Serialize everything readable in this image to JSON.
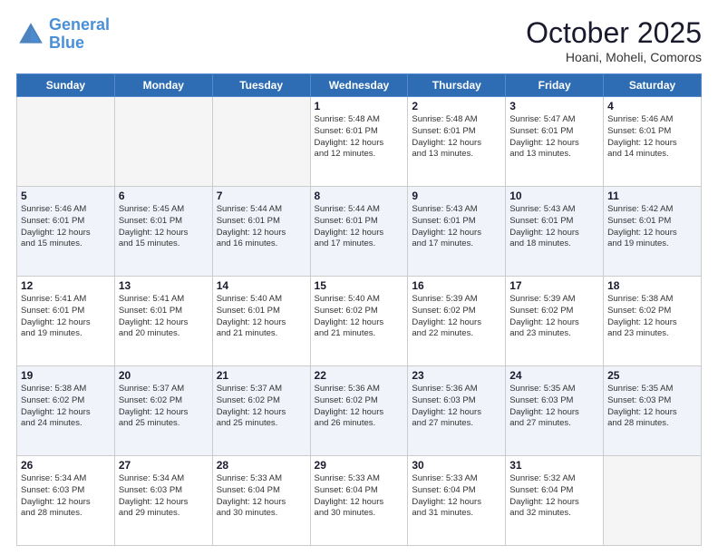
{
  "header": {
    "logo_general": "General",
    "logo_blue": "Blue",
    "month": "October 2025",
    "location": "Hoani, Moheli, Comoros"
  },
  "days_of_week": [
    "Sunday",
    "Monday",
    "Tuesday",
    "Wednesday",
    "Thursday",
    "Friday",
    "Saturday"
  ],
  "weeks": [
    [
      {
        "day": "",
        "info": ""
      },
      {
        "day": "",
        "info": ""
      },
      {
        "day": "",
        "info": ""
      },
      {
        "day": "1",
        "info": "Sunrise: 5:48 AM\nSunset: 6:01 PM\nDaylight: 12 hours\nand 12 minutes."
      },
      {
        "day": "2",
        "info": "Sunrise: 5:48 AM\nSunset: 6:01 PM\nDaylight: 12 hours\nand 13 minutes."
      },
      {
        "day": "3",
        "info": "Sunrise: 5:47 AM\nSunset: 6:01 PM\nDaylight: 12 hours\nand 13 minutes."
      },
      {
        "day": "4",
        "info": "Sunrise: 5:46 AM\nSunset: 6:01 PM\nDaylight: 12 hours\nand 14 minutes."
      }
    ],
    [
      {
        "day": "5",
        "info": "Sunrise: 5:46 AM\nSunset: 6:01 PM\nDaylight: 12 hours\nand 15 minutes."
      },
      {
        "day": "6",
        "info": "Sunrise: 5:45 AM\nSunset: 6:01 PM\nDaylight: 12 hours\nand 15 minutes."
      },
      {
        "day": "7",
        "info": "Sunrise: 5:44 AM\nSunset: 6:01 PM\nDaylight: 12 hours\nand 16 minutes."
      },
      {
        "day": "8",
        "info": "Sunrise: 5:44 AM\nSunset: 6:01 PM\nDaylight: 12 hours\nand 17 minutes."
      },
      {
        "day": "9",
        "info": "Sunrise: 5:43 AM\nSunset: 6:01 PM\nDaylight: 12 hours\nand 17 minutes."
      },
      {
        "day": "10",
        "info": "Sunrise: 5:43 AM\nSunset: 6:01 PM\nDaylight: 12 hours\nand 18 minutes."
      },
      {
        "day": "11",
        "info": "Sunrise: 5:42 AM\nSunset: 6:01 PM\nDaylight: 12 hours\nand 19 minutes."
      }
    ],
    [
      {
        "day": "12",
        "info": "Sunrise: 5:41 AM\nSunset: 6:01 PM\nDaylight: 12 hours\nand 19 minutes."
      },
      {
        "day": "13",
        "info": "Sunrise: 5:41 AM\nSunset: 6:01 PM\nDaylight: 12 hours\nand 20 minutes."
      },
      {
        "day": "14",
        "info": "Sunrise: 5:40 AM\nSunset: 6:01 PM\nDaylight: 12 hours\nand 21 minutes."
      },
      {
        "day": "15",
        "info": "Sunrise: 5:40 AM\nSunset: 6:02 PM\nDaylight: 12 hours\nand 21 minutes."
      },
      {
        "day": "16",
        "info": "Sunrise: 5:39 AM\nSunset: 6:02 PM\nDaylight: 12 hours\nand 22 minutes."
      },
      {
        "day": "17",
        "info": "Sunrise: 5:39 AM\nSunset: 6:02 PM\nDaylight: 12 hours\nand 23 minutes."
      },
      {
        "day": "18",
        "info": "Sunrise: 5:38 AM\nSunset: 6:02 PM\nDaylight: 12 hours\nand 23 minutes."
      }
    ],
    [
      {
        "day": "19",
        "info": "Sunrise: 5:38 AM\nSunset: 6:02 PM\nDaylight: 12 hours\nand 24 minutes."
      },
      {
        "day": "20",
        "info": "Sunrise: 5:37 AM\nSunset: 6:02 PM\nDaylight: 12 hours\nand 25 minutes."
      },
      {
        "day": "21",
        "info": "Sunrise: 5:37 AM\nSunset: 6:02 PM\nDaylight: 12 hours\nand 25 minutes."
      },
      {
        "day": "22",
        "info": "Sunrise: 5:36 AM\nSunset: 6:02 PM\nDaylight: 12 hours\nand 26 minutes."
      },
      {
        "day": "23",
        "info": "Sunrise: 5:36 AM\nSunset: 6:03 PM\nDaylight: 12 hours\nand 27 minutes."
      },
      {
        "day": "24",
        "info": "Sunrise: 5:35 AM\nSunset: 6:03 PM\nDaylight: 12 hours\nand 27 minutes."
      },
      {
        "day": "25",
        "info": "Sunrise: 5:35 AM\nSunset: 6:03 PM\nDaylight: 12 hours\nand 28 minutes."
      }
    ],
    [
      {
        "day": "26",
        "info": "Sunrise: 5:34 AM\nSunset: 6:03 PM\nDaylight: 12 hours\nand 28 minutes."
      },
      {
        "day": "27",
        "info": "Sunrise: 5:34 AM\nSunset: 6:03 PM\nDaylight: 12 hours\nand 29 minutes."
      },
      {
        "day": "28",
        "info": "Sunrise: 5:33 AM\nSunset: 6:04 PM\nDaylight: 12 hours\nand 30 minutes."
      },
      {
        "day": "29",
        "info": "Sunrise: 5:33 AM\nSunset: 6:04 PM\nDaylight: 12 hours\nand 30 minutes."
      },
      {
        "day": "30",
        "info": "Sunrise: 5:33 AM\nSunset: 6:04 PM\nDaylight: 12 hours\nand 31 minutes."
      },
      {
        "day": "31",
        "info": "Sunrise: 5:32 AM\nSunset: 6:04 PM\nDaylight: 12 hours\nand 32 minutes."
      },
      {
        "day": "",
        "info": ""
      }
    ]
  ]
}
